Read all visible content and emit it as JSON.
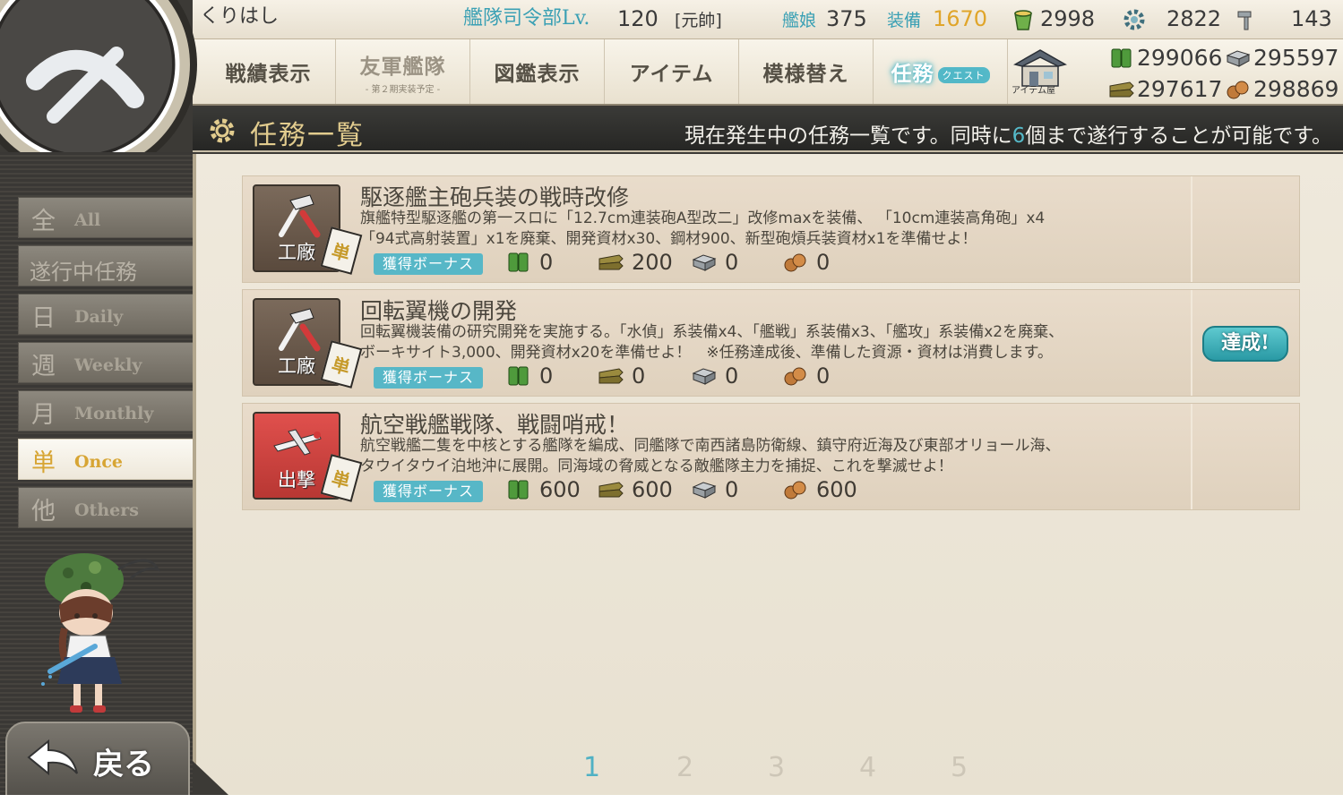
{
  "header": {
    "admiral_name": "くりはし",
    "hq_label": "艦隊司令部Lv.",
    "hq_level": "120",
    "hq_rank": "[元帥]",
    "ship_label": "艦娘",
    "ship_count": "375",
    "equip_label": "装備",
    "equip_count": "1670",
    "bucket_count": "2998",
    "devmat_count": "2822",
    "screw_count": "143"
  },
  "menu": {
    "items": [
      {
        "label": "戦績表示",
        "sub": ""
      },
      {
        "label": "友軍艦隊",
        "sub": "- 第２期実装予定 -"
      },
      {
        "label": "図鑑表示",
        "sub": ""
      },
      {
        "label": "アイテム",
        "sub": ""
      },
      {
        "label": "模様替え",
        "sub": ""
      },
      {
        "label": "任務",
        "sub": "",
        "tag": "クエスト"
      }
    ],
    "item_shop_label": "アイテム屋"
  },
  "resources": {
    "fuel": "299066",
    "ammo": "295597",
    "steel": "297617",
    "bauxite": "298869"
  },
  "title": {
    "text": "任務一覧",
    "desc_before": "現在発生中の任務一覧です。同時に",
    "desc_highlight": "6",
    "desc_after": "個まで遂行することが可能です。"
  },
  "sidebar": {
    "tabs": [
      {
        "kanji": "全",
        "en": "All",
        "active": false
      },
      {
        "full": "遂行中任務",
        "active": false
      },
      {
        "kanji": "日",
        "en": "Daily",
        "active": false
      },
      {
        "kanji": "週",
        "en": "Weekly",
        "active": false
      },
      {
        "kanji": "月",
        "en": "Monthly",
        "active": false
      },
      {
        "kanji": "単",
        "en": "Once",
        "active": true
      },
      {
        "kanji": "他",
        "en": "Others",
        "active": false
      }
    ],
    "back_label": "戻る"
  },
  "quests": [
    {
      "category": "工廠",
      "type_badge": "単",
      "title": "駆逐艦主砲兵装の戦時改修",
      "desc_line1": "旗艦特型駆逐艦の第一スロに「12.7cm連装砲A型改二」改修maxを装備、 「10cm連装高角砲」x4",
      "desc_line2": "「94式高射装置」x1を廃棄、開発資材x30、鋼材900、新型砲熕兵装資材x1を準備せよ！",
      "bonus_label": "獲得ボーナス",
      "fuel": "0",
      "ammo": "200",
      "steel": "0",
      "bauxite": "0",
      "complete": ""
    },
    {
      "category": "工廠",
      "type_badge": "単",
      "title": "回転翼機の開発",
      "desc_line1": "回転翼機装備の研究開発を実施する。「水偵」系装備x4、「艦戦」系装備x3、「艦攻」系装備x2を廃棄、",
      "desc_line2": "ボーキサイト3,000、開発資材x20を準備せよ！　※任務達成後、準備した資源・資材は消費します。",
      "bonus_label": "獲得ボーナス",
      "fuel": "0",
      "ammo": "0",
      "steel": "0",
      "bauxite": "0",
      "complete": "達成!"
    },
    {
      "category": "出撃",
      "type_badge": "単",
      "title": "航空戦艦戦隊、戦闘哨戒！",
      "desc_line1": "航空戦艦二隻を中核とする艦隊を編成、同艦隊で南西諸島防衛線、鎮守府近海及び東部オリョール海、",
      "desc_line2": "タウイタウイ泊地沖に展開。同海域の脅威となる敵艦隊主力を捕捉、これを撃滅せよ！",
      "bonus_label": "獲得ボーナス",
      "fuel": "600",
      "ammo": "600",
      "steel": "0",
      "bauxite": "600",
      "complete": ""
    }
  ],
  "pager": {
    "pages": [
      "1",
      "2",
      "3",
      "4",
      "5"
    ],
    "current": "1"
  },
  "colors": {
    "accent": "#55b9c8",
    "gold": "#d7a534",
    "equip_count": "#e0a52a",
    "sortie_red": "#e0504d"
  }
}
